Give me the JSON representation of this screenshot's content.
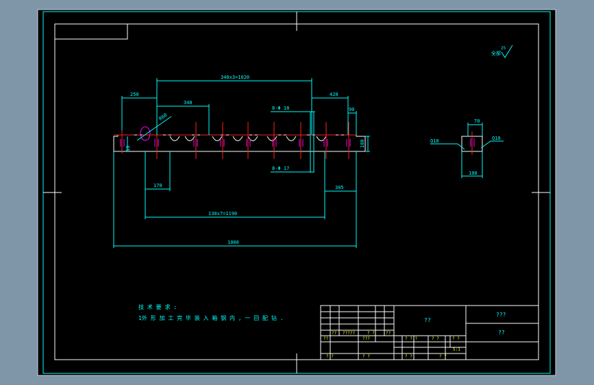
{
  "colors": {
    "app_background": "#7f95a8",
    "canvas": "#000000",
    "frame": "#ffffff",
    "dimension": "#00ffff",
    "part_outline": "#ffffff",
    "centerline": "#ff2020",
    "hole_mark": "#ff00ff",
    "table_text": "#ffff00",
    "title_text": "#00ffff"
  },
  "drawing": {
    "dimensions": {
      "total_length": "1000",
      "left_offset": "250",
      "first_pitch": "340",
      "pitch_span_top": "340x3=1020",
      "right_span": "420",
      "right_end": "90",
      "lower_offset": "170",
      "lower_pitch_span": "130x7=1190",
      "right_lower": "305",
      "hole_callout_top": "8-Φ 18",
      "hole_callout_bottom": "8-Φ 17",
      "height_left": "10",
      "height_right": "100",
      "radius": "R60"
    },
    "section": {
      "top_width": "70",
      "bottom_width": "100",
      "left_callout": "Q10",
      "right_callout": "Q10"
    },
    "roughness": {
      "text": "全部",
      "value": "25"
    },
    "notes": {
      "heading": "技 术 要 求 :",
      "line1": "1外 形 加 工 完 毕 装 入 箱 钢 内 , 一 回 配 钻 ."
    }
  },
  "title_block": {
    "name_field": "??",
    "company_field": "???",
    "drawing_no": "??",
    "cells": {
      "row1_a": "??",
      "row1_b": "??",
      "row1_c": "?????",
      "row1_d": "? ?",
      "row1_e": "??",
      "row2_a": "? ?",
      "row2_b": "???",
      "row2_c": "? ? ?",
      "row2_d": "? ?",
      "row2_e": "? ?",
      "row3_scale": "5:1",
      "row4_a": "? ?",
      "row4_b": "? ?",
      "row4_c": "? ?",
      "row4_d": "? ?"
    }
  }
}
